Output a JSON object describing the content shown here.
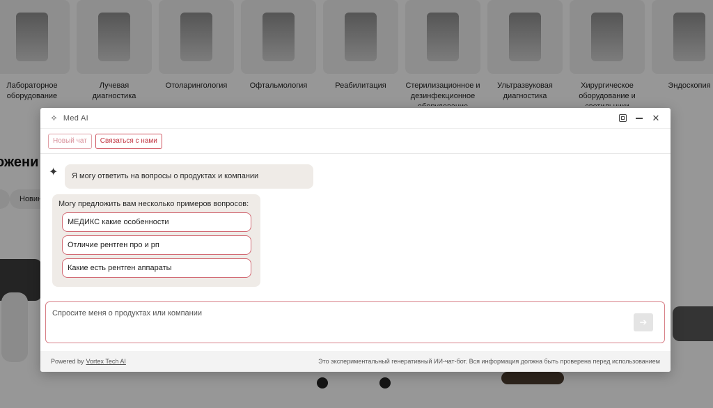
{
  "background": {
    "categories": [
      "Лабораторное оборудование",
      "Лучевая диагностика",
      "Отоларингология",
      "Офтальмология",
      "Реабилитация",
      "Стерилизационное и дезинфекционное оборудование",
      "Ультразвуковая диагностика",
      "Хирургическое оборудование и светильники",
      "Эндоскопия"
    ],
    "heading": "ожени",
    "pill": "Новин"
  },
  "dialog": {
    "title": "Med AI",
    "title_icon": "sparkle-icon",
    "toolbar": {
      "new_chat": "Новый чат",
      "contact": "Связаться с нами"
    },
    "messages": {
      "intro": "Я могу ответить на вопросы о продуктах и компании",
      "suggest_label": "Могу предложить вам несколько примеров вопросов:",
      "suggestions": [
        "МЕДИКС какие особенности",
        "Отличие рентген про и  рп",
        "Какие есть рентген аппараты"
      ]
    },
    "input": {
      "placeholder": "Спросите меня о продуктах или компании"
    },
    "footer": {
      "powered_prefix": "Powered by",
      "powered_link": "Vortex Tech AI",
      "note": "Это экспериментальный генеративный ИИ-чат-бот. Вся информация должна быть проверена перед использованием"
    }
  },
  "colors": {
    "accent": "#c0323f",
    "bubble": "#efebe7"
  }
}
